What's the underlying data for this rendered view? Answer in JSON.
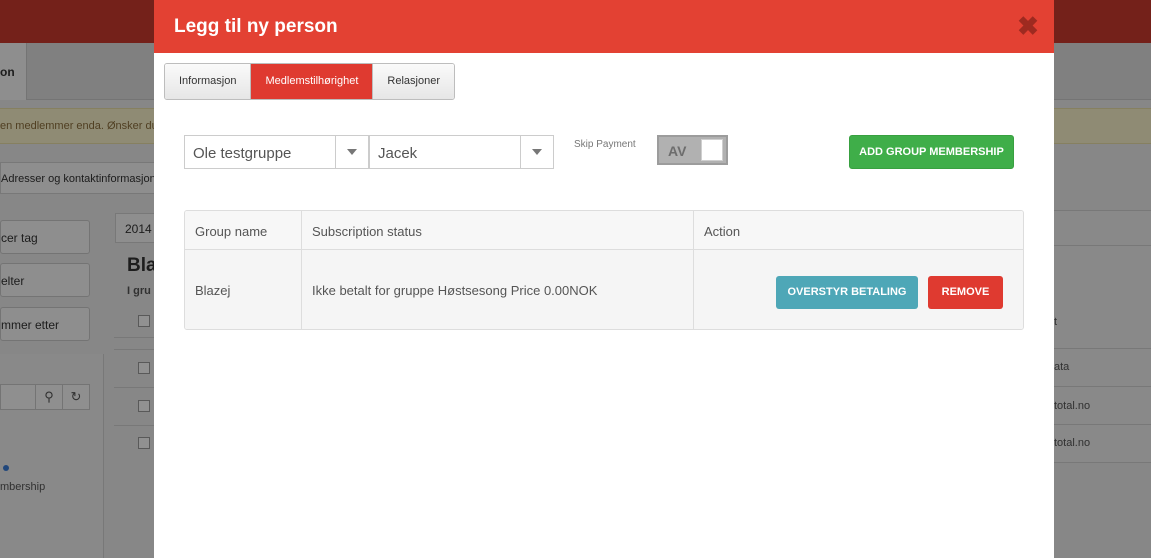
{
  "background": {
    "tab_fragment": "on",
    "notice_fragment": "en medlemmer enda. Ønsker du",
    "crumb_fragment": "Adresser og kontaktinformasjon",
    "buttons": [
      "cer tag",
      "elter",
      "mmer etter"
    ],
    "membership_fragment": "mbership",
    "year_fragment": "2014",
    "heading_fragment": "Bla",
    "subheading_fragment": "I gru",
    "right_col": {
      "header_fragment": "t",
      "ata_fragment": "ata",
      "email_fragments": [
        "total.no",
        "total.no"
      ]
    }
  },
  "modal": {
    "title": "Legg til ny person",
    "close_icon": "close-icon",
    "tabs": [
      {
        "label": "Informasjon",
        "active": false
      },
      {
        "label": "Medlemstilhørighet",
        "active": true
      },
      {
        "label": "Relasjoner",
        "active": false
      }
    ],
    "group_select": {
      "value": "Ole testgruppe"
    },
    "person_select": {
      "value": "Jacek"
    },
    "skip_payment": {
      "label": "Skip Payment",
      "state": "AV"
    },
    "add_button": "ADD GROUP MEMBERSHIP",
    "table": {
      "headers": [
        "Group name",
        "Subscription status",
        "Action"
      ],
      "rows": [
        {
          "group_name": "Blazej",
          "status": "Ikke betalt for gruppe Høstsesong Price 0.00NOK",
          "override_button": "OVERSTYR BETALING",
          "remove_button": "REMOVE"
        }
      ]
    }
  },
  "colors": {
    "header_red": "#e34133",
    "active_tab_red": "#df3a30",
    "green": "#3fae49",
    "teal": "#4ea7b7"
  }
}
